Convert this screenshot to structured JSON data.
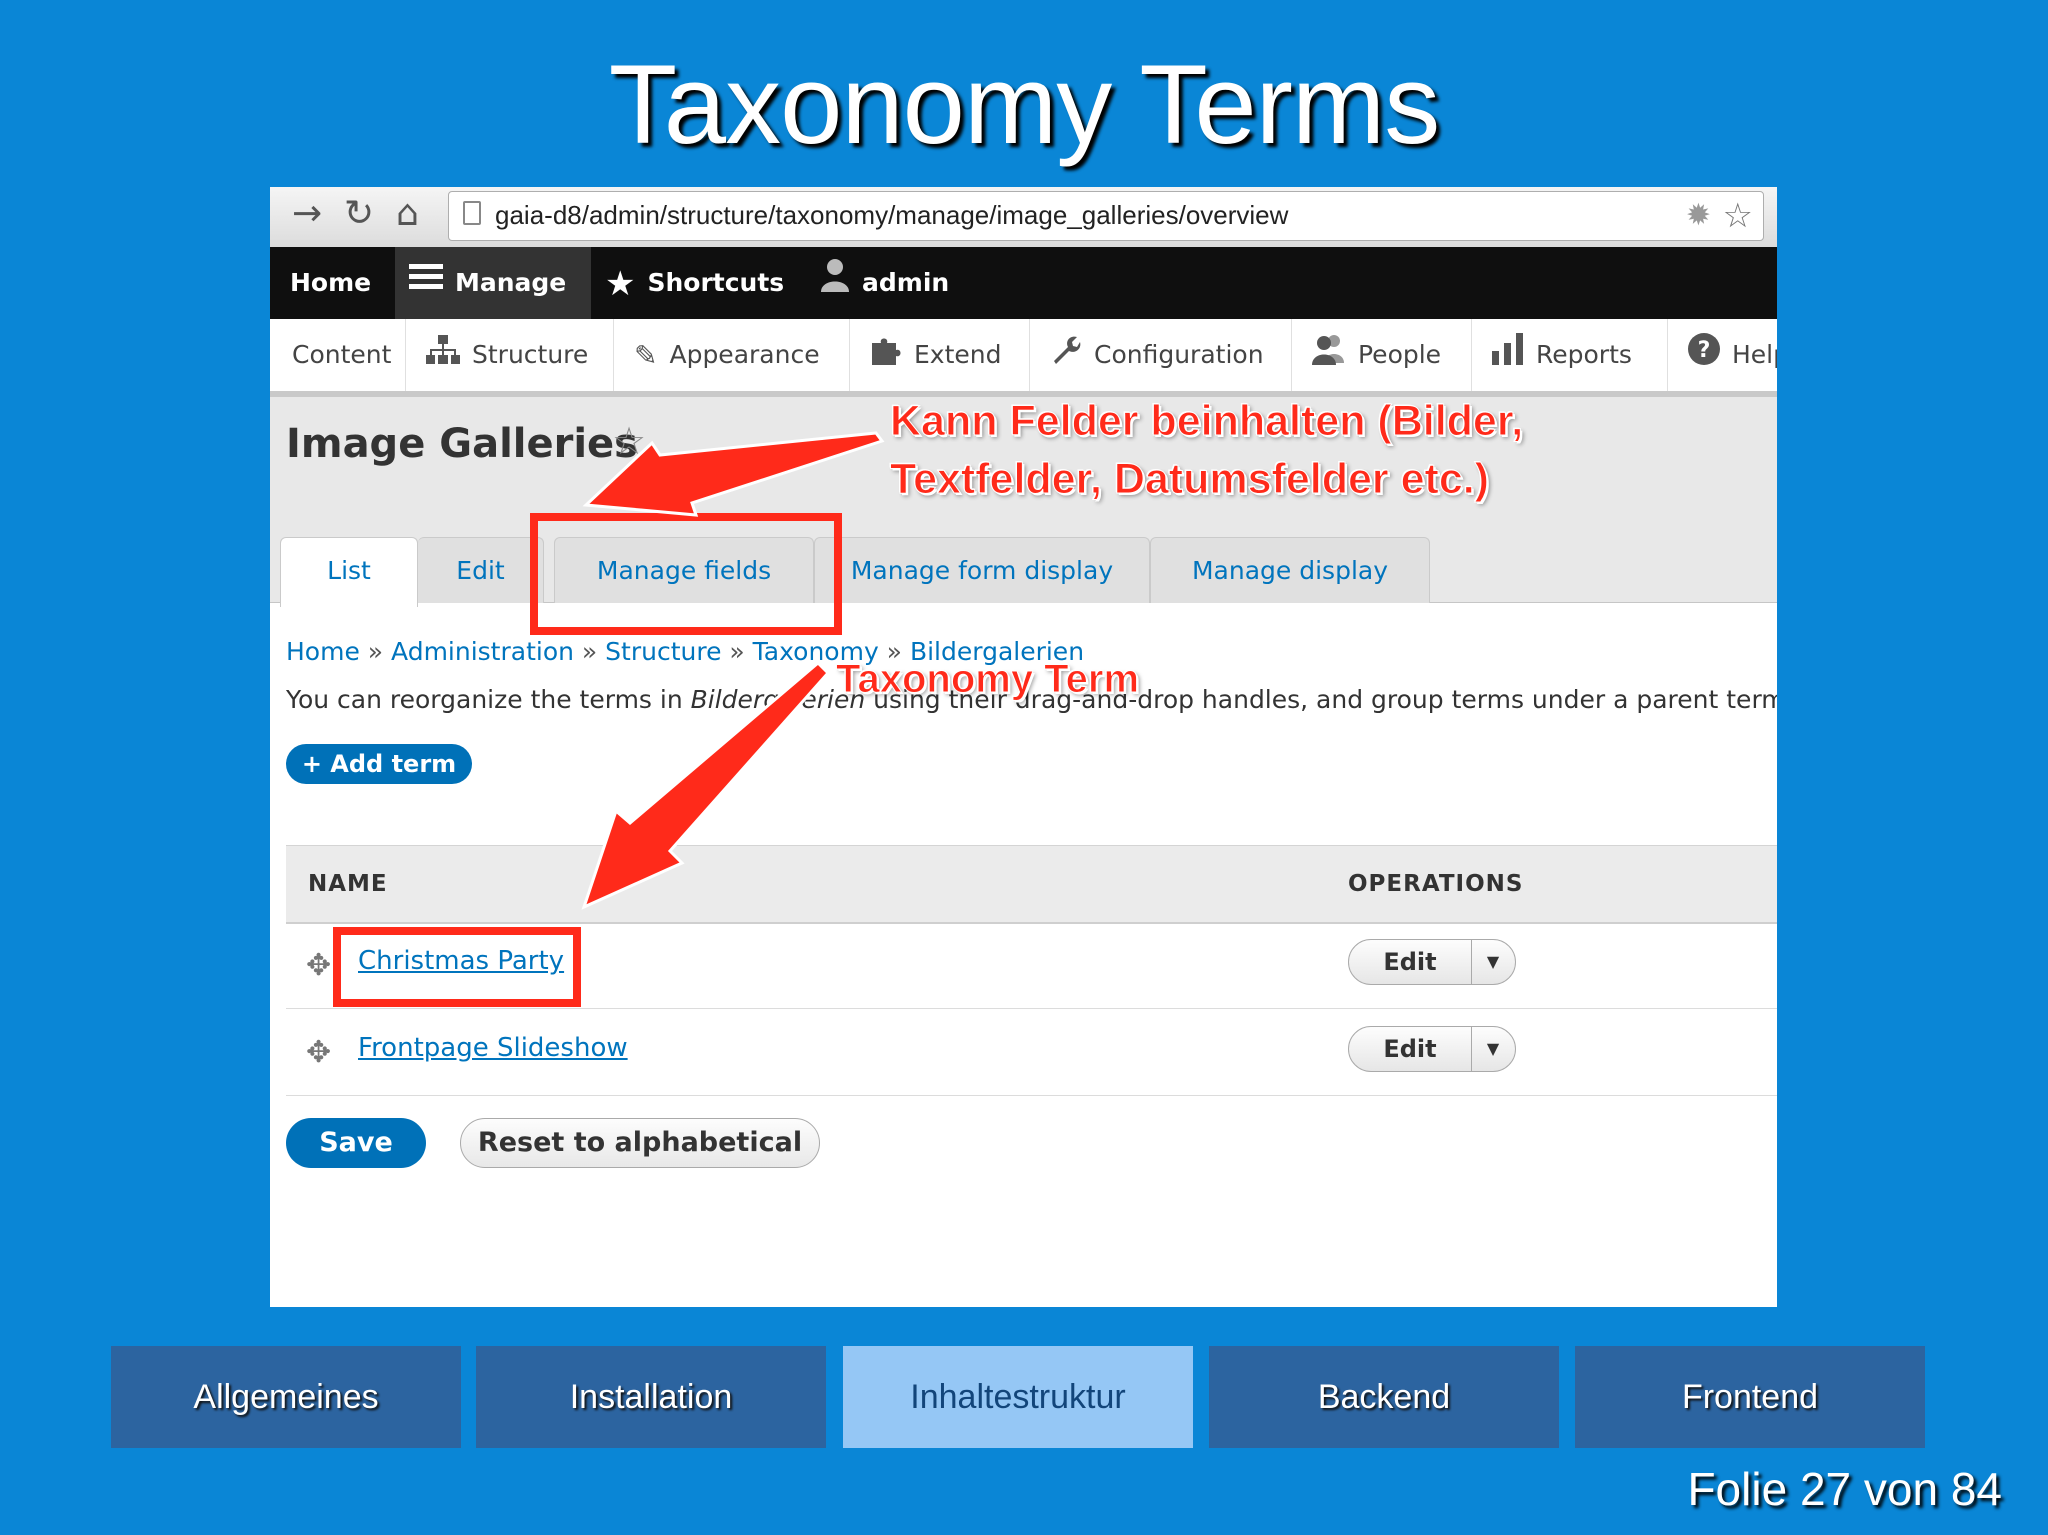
{
  "slide": {
    "title": "Taxonomy Terms",
    "counter": "Folie 27 von 84"
  },
  "browser": {
    "url": "gaia-d8/admin/structure/taxonomy/manage/image_galleries/overview",
    "icons": [
      "forward-arrow-icon",
      "reload-icon",
      "home-icon",
      "page-icon",
      "gear-icon",
      "bookmark-star-icon"
    ]
  },
  "toolbar": {
    "home": "Home",
    "manage": "Manage",
    "shortcuts": "Shortcuts",
    "admin": "admin"
  },
  "admin_menu": {
    "items": [
      "Content",
      "Structure",
      "Appearance",
      "Extend",
      "Configuration",
      "People",
      "Reports",
      "Help"
    ]
  },
  "page": {
    "title": "Image Galleries",
    "tabs": [
      "List",
      "Edit",
      "Manage fields",
      "Manage form display",
      "Manage display"
    ],
    "active_tab": "List",
    "breadcrumb": [
      "Home",
      "Administration",
      "Structure",
      "Taxonomy",
      "Bildergalerien"
    ],
    "description_prefix": "You can reorganize the terms in ",
    "description_em": "Bildergalerien",
    "description_suffix": " using their drag-and-drop handles, and group terms under a parent term by sliding them under and to the right of the parent.",
    "add_term": "+ Add term",
    "table": {
      "headers": [
        "NAME",
        "OPERATIONS"
      ],
      "rows": [
        {
          "name": "Christmas Party",
          "operation": "Edit"
        },
        {
          "name": "Frontpage Slideshow",
          "operation": "Edit"
        }
      ]
    },
    "save": "Save",
    "reset": "Reset to alphabetical"
  },
  "annotations": {
    "fields_line1": "Kann Felder beinhalten (Bilder,",
    "fields_line2": "Textfelder, Datumsfelder etc.)",
    "term": "Taxonomy Term",
    "color": "#ff2a1a"
  },
  "slide_nav": {
    "items": [
      "Allgemeines",
      "Installation",
      "Inhaltestruktur",
      "Backend",
      "Frontend"
    ],
    "active": "Inhaltestruktur"
  },
  "colors": {
    "background": "#0a86d6",
    "nav_button": "#2c64a0",
    "nav_active": "#95c7f5",
    "link": "#0074bd",
    "primary_button": "#0071b8"
  }
}
